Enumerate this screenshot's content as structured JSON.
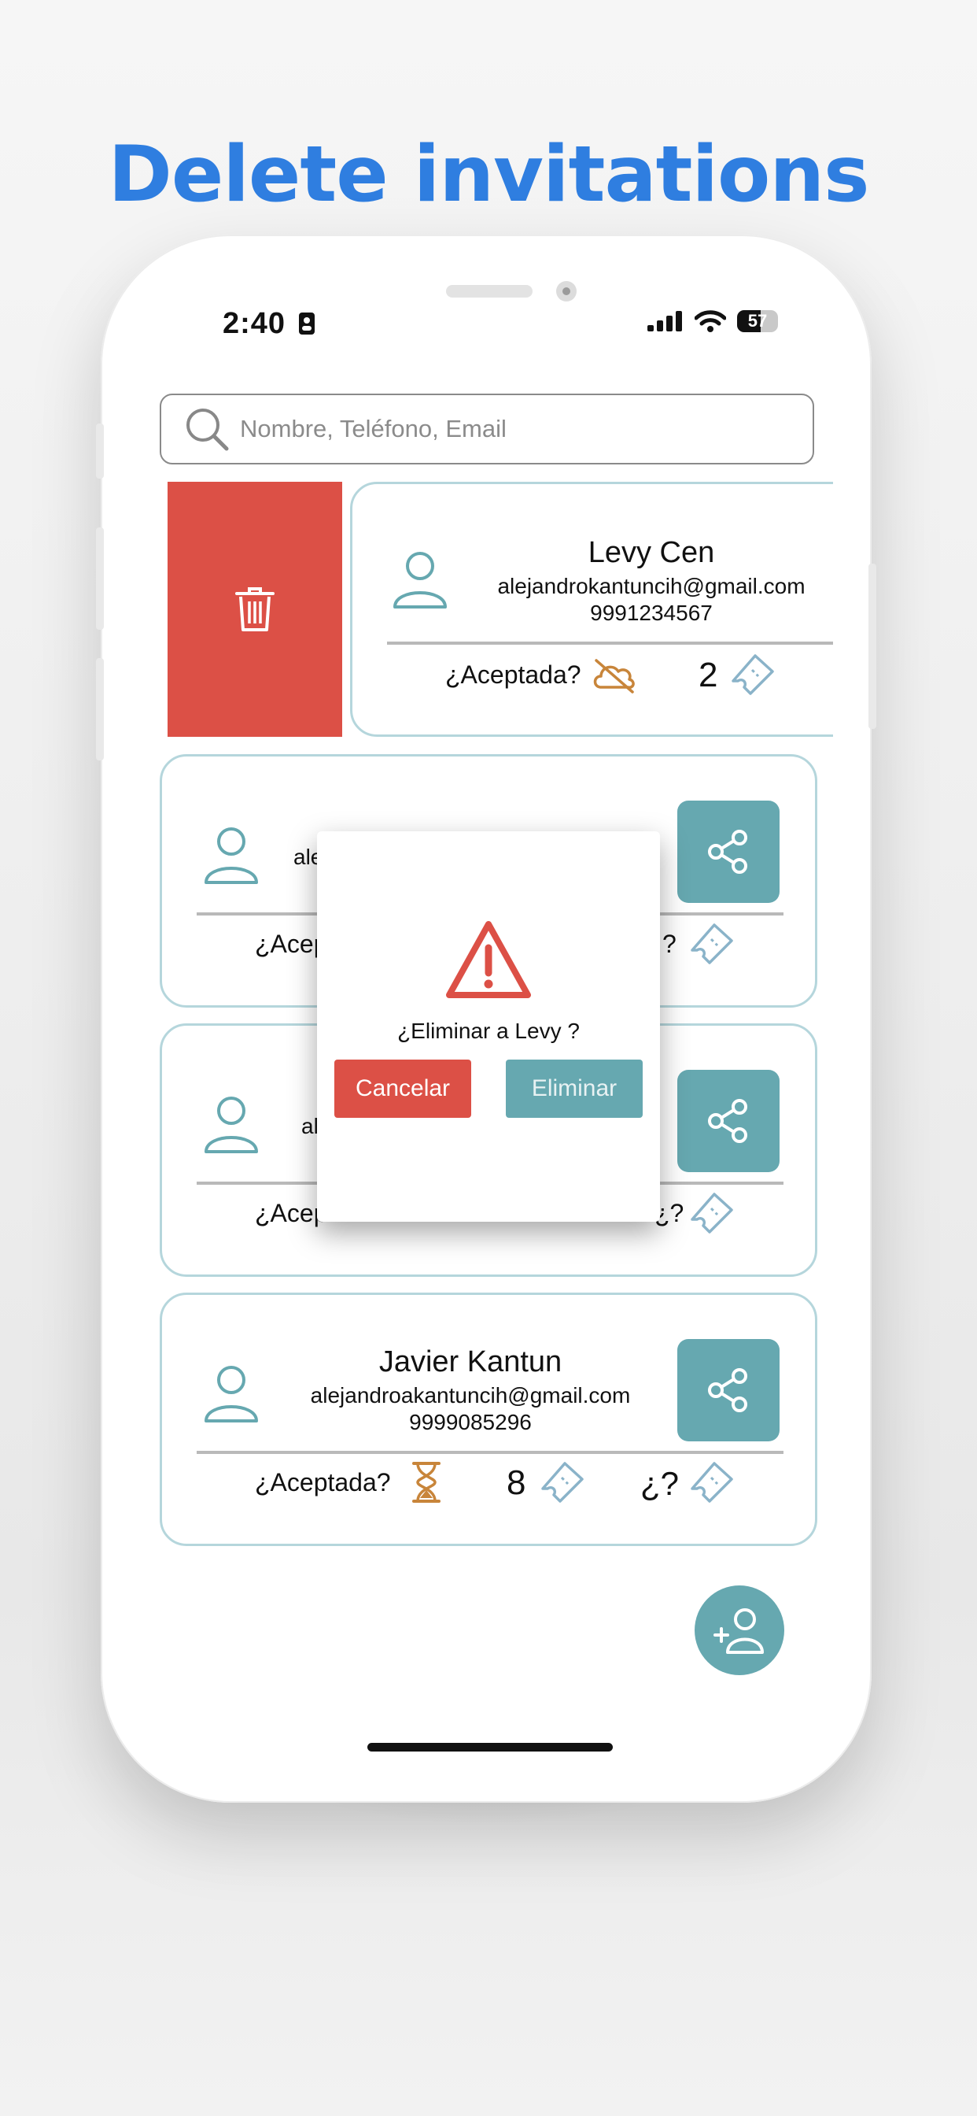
{
  "headline": "Delete invitations",
  "status": {
    "time": "2:40",
    "battery": "57"
  },
  "search": {
    "placeholder": "Nombre, Teléfono, Email"
  },
  "swiped_card": {
    "name": "Levy  Cen",
    "email": "alejandrokantuncih@gmail.com",
    "phone": "9991234567",
    "accepted_label": "¿Aceptada?",
    "tickets": "2"
  },
  "partial_cards": [
    {
      "email_fragment": "ale",
      "accepted_fragment": "¿Acep",
      "tail": "?"
    },
    {
      "email_fragment": "al",
      "accepted_fragment": "¿Acep",
      "tail": "¿?"
    }
  ],
  "card_last": {
    "name": "Javier Kantun",
    "email": "alejandroakantuncih@gmail.com",
    "phone": "9999085296",
    "accepted_label": "¿Aceptada?",
    "tickets": "8",
    "extra": "¿?"
  },
  "dialog": {
    "question": "¿Eliminar a Levy ?",
    "cancel_label": "Cancelar",
    "delete_label": "Eliminar"
  },
  "colors": {
    "accent": "#66a8b0",
    "danger": "#dc5046",
    "headline": "#2f7ee0",
    "pending": "#c8853a"
  }
}
